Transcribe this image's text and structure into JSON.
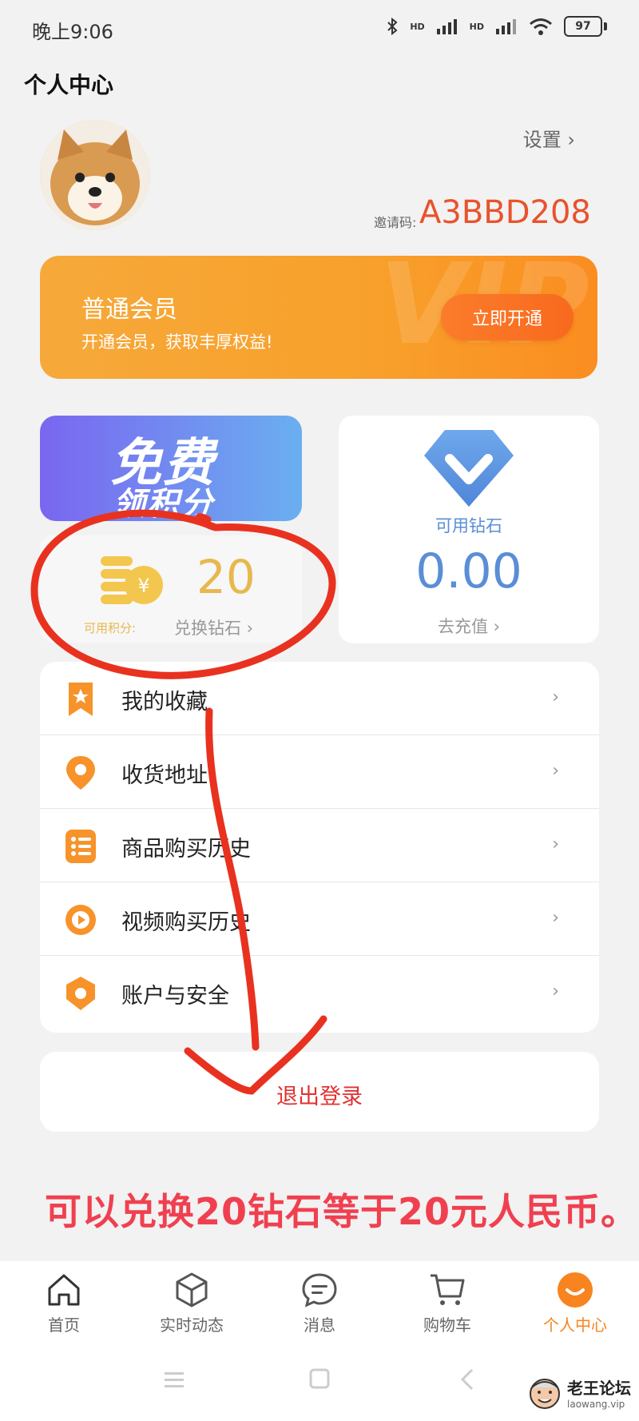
{
  "status_bar": {
    "time": "晚上9:06",
    "hd1": "HD",
    "hd2": "HD",
    "battery": "97"
  },
  "header": {
    "title": "个人中心",
    "settings": "设置 ›",
    "invite_label": "邀请码:",
    "invite_code": "A3BBD208"
  },
  "vip": {
    "watermark": "VIP",
    "title": "普通会员",
    "subtitle": "开通会员，获取丰厚权益!",
    "button": "立即开通"
  },
  "free_banner": {
    "big": "免费",
    "small": "领积分"
  },
  "points": {
    "value": "20",
    "label": "可用积分:",
    "link": "兑换钻石 ›"
  },
  "diamond": {
    "label": "可用钻石",
    "value": "0.00",
    "link": "去充值 ›"
  },
  "menu": {
    "items": [
      {
        "label": "我的收藏",
        "icon": "bookmark-icon"
      },
      {
        "label": "收货地址",
        "icon": "location-pin-icon"
      },
      {
        "label": "商品购买历史",
        "icon": "list-icon"
      },
      {
        "label": "视频购买历史",
        "icon": "play-icon"
      },
      {
        "label": "账户与安全",
        "icon": "shield-icon"
      }
    ],
    "chevron": "›"
  },
  "logout": {
    "label": "退出登录"
  },
  "caption": "可以兑换20钻石等于20元人民币。",
  "tabbar": {
    "tabs": [
      {
        "label": "首页",
        "icon": "home-icon",
        "active": false
      },
      {
        "label": "实时动态",
        "icon": "cube-icon",
        "active": false
      },
      {
        "label": "消息",
        "icon": "chat-icon",
        "active": false
      },
      {
        "label": "购物车",
        "icon": "cart-icon",
        "active": false
      },
      {
        "label": "个人中心",
        "icon": "profile-smile-icon",
        "active": true
      }
    ]
  },
  "watermark": {
    "title": "老王论坛",
    "sub": "laowang.vip"
  },
  "colors": {
    "accent_orange": "#f8a02b",
    "invite_red": "#e8532c",
    "diamond_blue": "#5a8ed6",
    "points_gold": "#e7b84e",
    "logout_red": "#e03131",
    "annotation_red": "#e8321f"
  }
}
